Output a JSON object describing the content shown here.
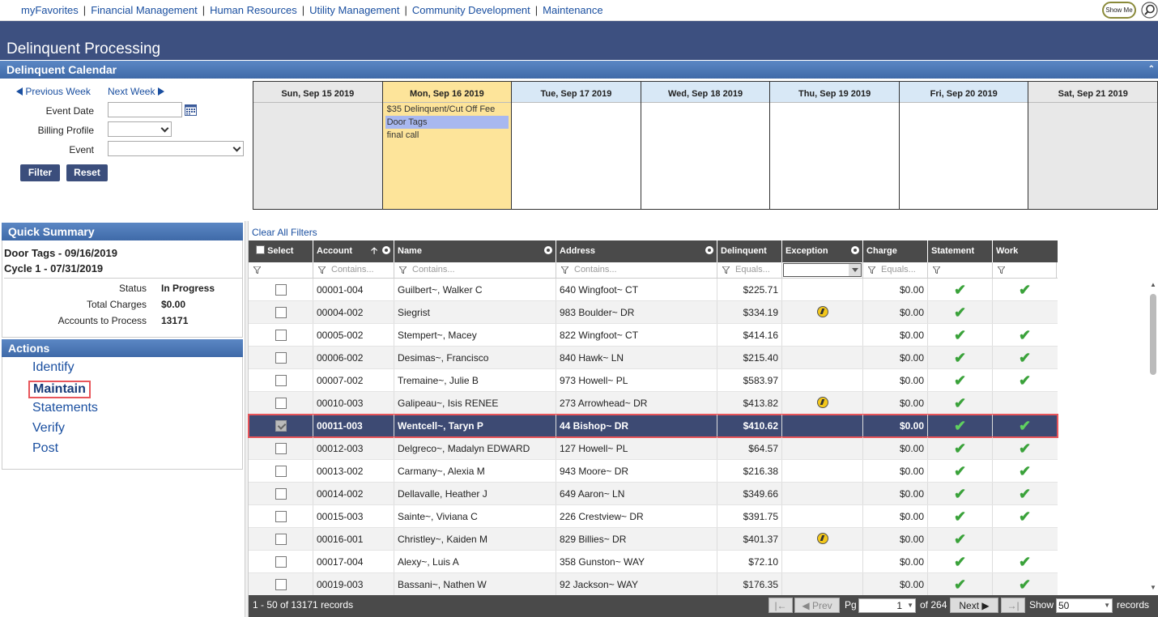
{
  "nav": {
    "links": [
      "myFavorites",
      "Financial Management",
      "Human Resources",
      "Utility Management",
      "Community Development",
      "Maintenance"
    ],
    "showme_label": "Show Me"
  },
  "page_title": "Delinquent Processing",
  "calendar": {
    "header": "Delinquent Calendar",
    "prev_week": "Previous Week",
    "next_week": "Next Week",
    "event_date_label": "Event Date",
    "event_date_value": "",
    "billing_profile_label": "Billing Profile",
    "billing_profile_value": "",
    "event_label": "Event",
    "event_value": "",
    "filter_label": "Filter",
    "reset_label": "Reset",
    "days": [
      {
        "label": "Sun, Sep 15 2019",
        "kind": "weekend",
        "events": []
      },
      {
        "label": "Mon, Sep 16 2019",
        "kind": "today",
        "events": [
          "$35 Delinquent/Cut Off Fee",
          "Door Tags",
          "final call"
        ],
        "selected_event": 1
      },
      {
        "label": "Tue, Sep 17 2019",
        "kind": "weekday",
        "events": []
      },
      {
        "label": "Wed, Sep 18 2019",
        "kind": "weekday",
        "events": []
      },
      {
        "label": "Thu, Sep 19 2019",
        "kind": "weekday",
        "events": []
      },
      {
        "label": "Fri, Sep 20 2019",
        "kind": "weekday",
        "events": []
      },
      {
        "label": "Sat, Sep 21 2019",
        "kind": "weekend",
        "events": []
      }
    ]
  },
  "quick_summary": {
    "header": "Quick Summary",
    "line1": "Door Tags - 09/16/2019",
    "line2": "Cycle 1 - 07/31/2019",
    "status_label": "Status",
    "status_value": "In Progress",
    "charges_label": "Total Charges",
    "charges_value": "$0.00",
    "accounts_label": "Accounts to Process",
    "accounts_value": "13171"
  },
  "actions": {
    "header": "Actions",
    "items": [
      "Identify",
      "Maintain",
      "Statements",
      "Verify",
      "Post"
    ],
    "active_index": 1
  },
  "grid": {
    "clear_filters": "Clear All Filters",
    "columns": {
      "select": "Select",
      "account": "Account",
      "name": "Name",
      "address": "Address",
      "delinquent": "Delinquent",
      "exception": "Exception",
      "charge": "Charge",
      "statement": "Statement",
      "work": "Work"
    },
    "filter_placeholders": {
      "account": "Contains...",
      "name": "Contains...",
      "address": "Contains...",
      "delinquent": "Equals...",
      "charge": "Equals..."
    },
    "rows": [
      {
        "account": "00001-004",
        "name": "Guilbert~, Walker C",
        "address": "640 Wingfoot~ CT",
        "delinquent": "$225.71",
        "exception": false,
        "charge": "$0.00",
        "statement": true,
        "work": true,
        "selected": false
      },
      {
        "account": "00004-002",
        "name": "Siegrist",
        "address": "983 Boulder~ DR",
        "delinquent": "$334.19",
        "exception": true,
        "charge": "$0.00",
        "statement": true,
        "work": false,
        "selected": false
      },
      {
        "account": "00005-002",
        "name": "Stempert~, Macey",
        "address": "822 Wingfoot~ CT",
        "delinquent": "$414.16",
        "exception": false,
        "charge": "$0.00",
        "statement": true,
        "work": true,
        "selected": false
      },
      {
        "account": "00006-002",
        "name": "Desimas~, Francisco",
        "address": "840 Hawk~ LN",
        "delinquent": "$215.40",
        "exception": false,
        "charge": "$0.00",
        "statement": true,
        "work": true,
        "selected": false
      },
      {
        "account": "00007-002",
        "name": "Tremaine~, Julie B",
        "address": "973 Howell~ PL",
        "delinquent": "$583.97",
        "exception": false,
        "charge": "$0.00",
        "statement": true,
        "work": true,
        "selected": false
      },
      {
        "account": "00010-003",
        "name": "Galipeau~, Isis RENEE",
        "address": "273 Arrowhead~ DR",
        "delinquent": "$413.82",
        "exception": true,
        "charge": "$0.00",
        "statement": true,
        "work": false,
        "selected": false
      },
      {
        "account": "00011-003",
        "name": "Wentcell~, Taryn P",
        "address": "44 Bishop~ DR",
        "delinquent": "$410.62",
        "exception": false,
        "charge": "$0.00",
        "statement": true,
        "work": true,
        "selected": true
      },
      {
        "account": "00012-003",
        "name": "Delgreco~, Madalyn EDWARD",
        "address": "127 Howell~ PL",
        "delinquent": "$64.57",
        "exception": false,
        "charge": "$0.00",
        "statement": true,
        "work": true,
        "selected": false
      },
      {
        "account": "00013-002",
        "name": "Carmany~, Alexia M",
        "address": "943 Moore~ DR",
        "delinquent": "$216.38",
        "exception": false,
        "charge": "$0.00",
        "statement": true,
        "work": true,
        "selected": false
      },
      {
        "account": "00014-002",
        "name": "Dellavalle, Heather J",
        "address": "649 Aaron~ LN",
        "delinquent": "$349.66",
        "exception": false,
        "charge": "$0.00",
        "statement": true,
        "work": true,
        "selected": false
      },
      {
        "account": "00015-003",
        "name": "Sainte~, Viviana C",
        "address": "226 Crestview~ DR",
        "delinquent": "$391.75",
        "exception": false,
        "charge": "$0.00",
        "statement": true,
        "work": true,
        "selected": false
      },
      {
        "account": "00016-001",
        "name": "Christley~, Kaiden M",
        "address": "829 Billies~ DR",
        "delinquent": "$401.37",
        "exception": true,
        "charge": "$0.00",
        "statement": true,
        "work": false,
        "selected": false
      },
      {
        "account": "00017-004",
        "name": "Alexy~, Luis A",
        "address": "358 Gunston~ WAY",
        "delinquent": "$72.10",
        "exception": false,
        "charge": "$0.00",
        "statement": true,
        "work": true,
        "selected": false
      },
      {
        "account": "00019-003",
        "name": "Bassani~, Nathen W",
        "address": "92 Jackson~ WAY",
        "delinquent": "$176.35",
        "exception": false,
        "charge": "$0.00",
        "statement": true,
        "work": true,
        "selected": false
      }
    ]
  },
  "pager": {
    "records_text": "1 - 50 of 13171 records",
    "prev_label": "Prev",
    "pg_label": "Pg",
    "page_value": "1",
    "of_pages": "of 264",
    "next_label": "Next",
    "show_label": "Show",
    "show_value": "50",
    "records_label": "records"
  },
  "colors": {
    "banner": "#3d5080",
    "section_header": "#4a76b4",
    "selected_row": "#3d4a73",
    "highlight_border": "#e8555a",
    "check": "#3aa23a"
  }
}
